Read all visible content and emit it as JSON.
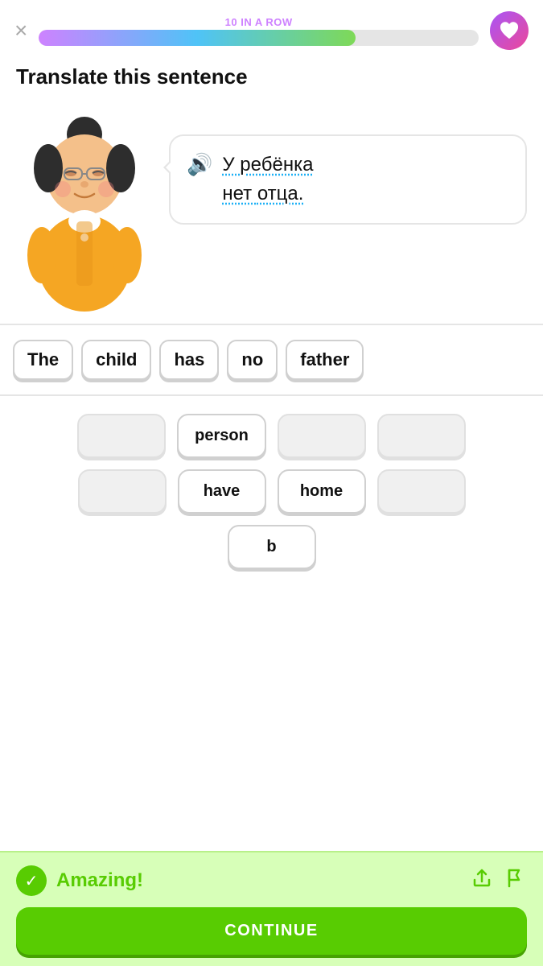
{
  "header": {
    "streak_label": "10 IN A ROW",
    "progress_percent": 72,
    "close_label": "×"
  },
  "page": {
    "title": "Translate this sentence"
  },
  "speech_bubble": {
    "russian_line1": "У ребёнка",
    "russian_line2": "нет отца."
  },
  "answer_words": [
    {
      "id": 1,
      "text": "The"
    },
    {
      "id": 2,
      "text": "child"
    },
    {
      "id": 3,
      "text": "has"
    },
    {
      "id": 4,
      "text": "no"
    },
    {
      "id": 5,
      "text": "father"
    }
  ],
  "word_bank": {
    "rows": [
      [
        {
          "id": "wb1",
          "text": "",
          "empty": true
        },
        {
          "id": "wb2",
          "text": "person",
          "empty": false
        },
        {
          "id": "wb3",
          "text": "",
          "empty": true
        },
        {
          "id": "wb4",
          "text": "",
          "empty": true
        }
      ],
      [
        {
          "id": "wb5",
          "text": "",
          "empty": true
        },
        {
          "id": "wb6",
          "text": "have",
          "empty": false
        },
        {
          "id": "wb7",
          "text": "home",
          "empty": false
        },
        {
          "id": "wb8",
          "text": "",
          "empty": true
        }
      ],
      [
        {
          "id": "wb9",
          "text": "b",
          "empty": false
        }
      ]
    ]
  },
  "feedback": {
    "amazing_text": "Amazing!",
    "continue_label": "CONTINUE"
  }
}
